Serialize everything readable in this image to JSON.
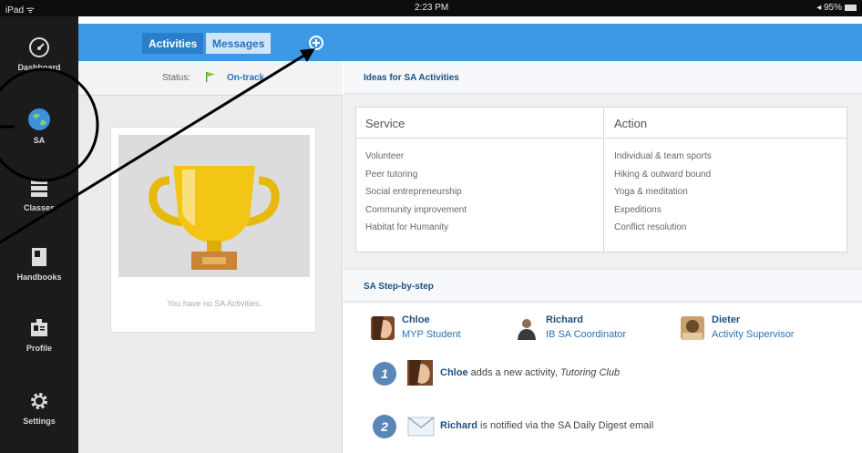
{
  "status_bar": {
    "carrier": "iPad ᯤ",
    "time": "2:23 PM",
    "battery": "◂ 95%"
  },
  "sidebar": {
    "items": [
      {
        "label": "Dashboard",
        "icon": "gauge-icon"
      },
      {
        "label": "SA",
        "icon": "globe-icon"
      },
      {
        "label": "Classes",
        "icon": "stack-icon"
      },
      {
        "label": "Handbooks",
        "icon": "book-icon"
      },
      {
        "label": "Profile",
        "icon": "id-badge-icon"
      },
      {
        "label": "Settings",
        "icon": "gear-icon"
      }
    ]
  },
  "header": {
    "tabs": [
      "Activities",
      "Messages"
    ],
    "add_icon": "plus-circle-icon"
  },
  "left": {
    "status_label": "Status:",
    "status_value": "On-track",
    "empty_text": "You have no SA Activities."
  },
  "ideas": {
    "title": "Ideas for SA Activities",
    "service": {
      "heading": "Service",
      "items": [
        "Volunteer",
        "Peer tutoring",
        "Social entrepreneurship",
        "Community improvement",
        "Habitat for Humanity"
      ]
    },
    "action": {
      "heading": "Action",
      "items": [
        "Individual & team sports",
        "Hiking & outward bound",
        "Yoga & meditation",
        "Expeditions",
        "Conflict resolution"
      ]
    }
  },
  "steps": {
    "title": "SA Step-by-step",
    "people": [
      {
        "name": "Chloe",
        "role": "MYP Student"
      },
      {
        "name": "Richard",
        "role": "IB SA Coordinator"
      },
      {
        "name": "Dieter",
        "role": "Activity Supervisor"
      }
    ],
    "items": [
      {
        "num": "1",
        "actor": "Chloe",
        "text": "adds a new activity,",
        "em": "Tutoring Club"
      },
      {
        "num": "2",
        "actor": "Richard",
        "text": "is notified via the SA Daily Digest email",
        "em": ""
      }
    ]
  },
  "colors": {
    "blue": "#3d99e6",
    "sidebar": "#1b1b1b",
    "annotation": "#000000"
  }
}
